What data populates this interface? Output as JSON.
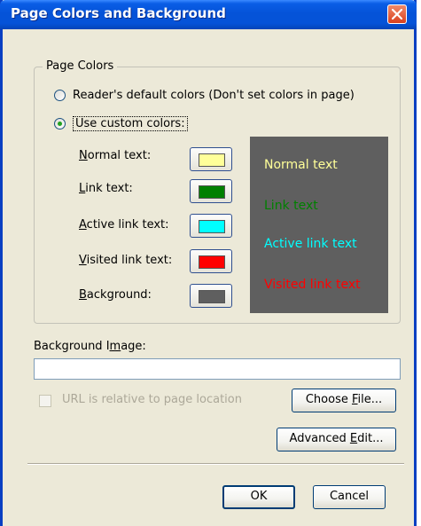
{
  "dialog": {
    "title": "Page Colors and Background"
  },
  "page_colors": {
    "legend": "Page Colors",
    "radio_default": {
      "label": "Reader's default colors (Don't set colors in page)",
      "selected": false
    },
    "radio_custom": {
      "label": "Use custom colors:",
      "selected": true
    },
    "rows": [
      {
        "key": "N",
        "rest": "ormal text:",
        "color": "#ffff99"
      },
      {
        "key": "L",
        "rest": "ink text:",
        "color": "#008000"
      },
      {
        "key": "A",
        "rest": "ctive link text:",
        "color": "#00ffff"
      },
      {
        "key": "V",
        "rest": "isited link text:",
        "color": "#ff0000"
      },
      {
        "key": "B",
        "rest": "ackground:",
        "color": "#5f5f5f"
      }
    ],
    "preview": [
      {
        "text": "Normal text",
        "color": "#ffff99"
      },
      {
        "text": "Link text",
        "color": "#008000"
      },
      {
        "text": "Active link text",
        "color": "#00ffff"
      },
      {
        "text": "Visited link text",
        "color": "#ff0000"
      }
    ]
  },
  "background_image": {
    "label_before": "Background I",
    "label_key": "m",
    "label_after": "age:",
    "value": "",
    "relative_checkbox": {
      "label": "URL is relative to page location",
      "checked": false,
      "disabled": true
    }
  },
  "buttons": {
    "choose_before": "Choose ",
    "choose_key": "F",
    "choose_after": "ile...",
    "advanced_before": "Advanced ",
    "advanced_key": "E",
    "advanced_after": "dit...",
    "ok": "OK",
    "cancel": "Cancel"
  }
}
